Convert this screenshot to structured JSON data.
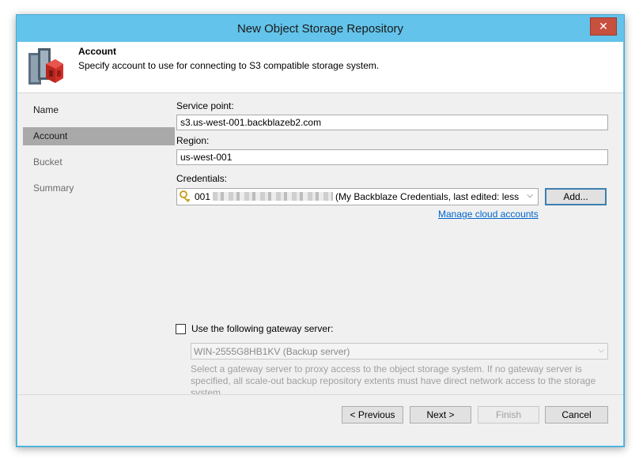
{
  "window": {
    "title": "New Object Storage Repository",
    "close_glyph": "✕"
  },
  "header": {
    "title": "Account",
    "subtitle": "Specify account to use for connecting to S3 compatible storage system.",
    "logo_icon": "object-storage-repository-icon"
  },
  "steps": [
    {
      "label": "Name",
      "state": "done"
    },
    {
      "label": "Account",
      "state": "active"
    },
    {
      "label": "Bucket",
      "state": "pending"
    },
    {
      "label": "Summary",
      "state": "pending"
    }
  ],
  "form": {
    "service_point_label": "Service point:",
    "service_point_value": "s3.us-west-001.backblazeb2.com",
    "region_label": "Region:",
    "region_value": "us-west-001",
    "credentials_label": "Credentials:",
    "credentials_prefix": "001",
    "credentials_suffix": "(My Backblaze Credentials, last edited: less than",
    "add_button": "Add...",
    "manage_link": "Manage cloud accounts",
    "gateway_checkbox_label": "Use the following gateway server:",
    "gateway_checked": false,
    "gateway_value": "WIN-2555G8HB1KV (Backup server)",
    "gateway_note": "Select a gateway server to proxy access to the object storage system. If no gateway server is specified, all scale-out backup repository extents must have direct network access to the storage system."
  },
  "footer": {
    "previous": "< Previous",
    "next": "Next >",
    "finish": "Finish",
    "cancel": "Cancel"
  },
  "colors": {
    "titlebar": "#63c3ea",
    "close_button": "#c7503f",
    "active_step": "#a9a9a9",
    "panel": "#f0f0f0",
    "link": "#0066cc"
  }
}
